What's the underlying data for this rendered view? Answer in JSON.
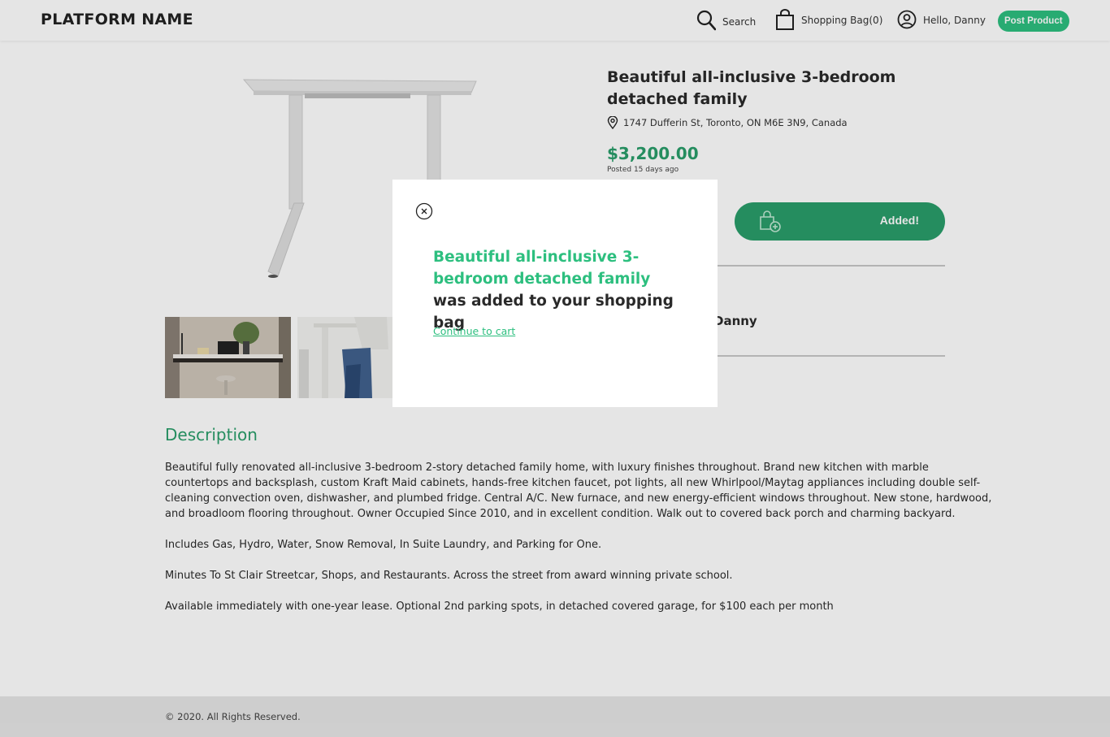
{
  "header": {
    "brand": "PLATFORM NAME",
    "search_label": "Search",
    "bag_label": "Shopping Bag(0)",
    "user_label": "Hello, Danny",
    "post_button": "Post Product"
  },
  "product": {
    "title": "Beautiful all-inclusive 3-bedroom detached family",
    "location": "1747 Dufferin St, Toronto, ON M6E 3N9, Canada",
    "price": "$3,200.00",
    "posted": "Posted 15 days ago",
    "added_button": "Added!",
    "seller_name_partial": "Danny"
  },
  "description": {
    "heading": "Description",
    "paragraphs": [
      "Beautiful fully renovated all-inclusive 3-bedroom 2-story detached family home, with luxury finishes throughout. Brand new kitchen with marble countertops and backsplash, custom Kraft Maid cabinets, hands-free kitchen faucet, pot lights, all new Whirlpool/Maytag appliances including double self-cleaning convection oven, dishwasher, and plumbed fridge. Central A/C. New furnace, and new energy-efficient windows throughout. New stone, hardwood, and broadloom flooring throughout. Owner Occupied Since 2010, and in excellent condition. Walk out to covered back porch and charming backyard.",
      "Includes Gas, Hydro, Water, Snow Removal, In Suite Laundry, and Parking for One.",
      "Minutes To St Clair Streetcar, Shops, and Restaurants. Across the street from award winning private school.",
      "Available immediately with one-year lease. Optional 2nd parking spots, in detached covered garage, for $100 each per month"
    ]
  },
  "footer": {
    "copyright": "© 2020. All Rights Reserved."
  },
  "modal": {
    "product_name": "Beautiful all-inclusive 3-bedroom detached family",
    "message_suffix": " was added to your shopping bag",
    "continue_link": "Continue to cart"
  },
  "colors": {
    "accent": "#2dbf7f",
    "accent_dark": "#2a9e6a"
  },
  "icons": [
    "search-icon",
    "shopping-bag-icon",
    "user-icon",
    "location-pin-icon",
    "bag-plus-icon",
    "close-icon"
  ]
}
